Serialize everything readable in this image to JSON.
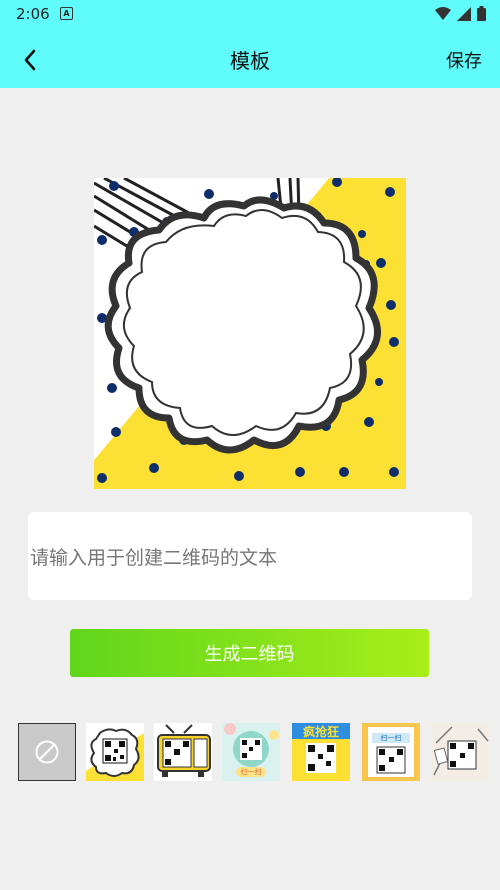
{
  "status_bar": {
    "time": "2:06",
    "app_icon_letter": "A",
    "icons": [
      "wifi-icon",
      "signal-icon",
      "battery-icon"
    ]
  },
  "app_bar": {
    "title": "模板",
    "save_label": "保存",
    "back_icon": "chevron-left-icon",
    "background": "#5ffcfb"
  },
  "input": {
    "placeholder": "请输入用于创建二维码的文本",
    "value": ""
  },
  "generate_button": {
    "label": "生成二维码",
    "colors": [
      "#5fd61c",
      "#a8ee19"
    ]
  },
  "templates": {
    "items": [
      {
        "name": "none",
        "icon": "no-symbol-icon",
        "selected": true
      },
      {
        "name": "comic-cloud"
      },
      {
        "name": "retro-tv"
      },
      {
        "name": "scan-badge",
        "text": "扫一扫"
      },
      {
        "name": "crazy-sale",
        "text": "疯抢狂"
      },
      {
        "name": "scan-banner",
        "text": "扫一扫"
      },
      {
        "name": "hand-drawn"
      }
    ]
  }
}
